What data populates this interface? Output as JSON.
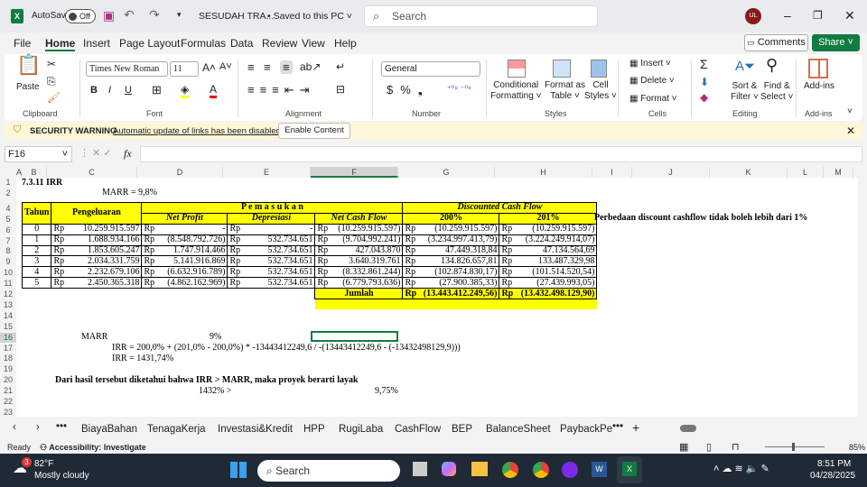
{
  "titlebar": {
    "autosave": "AutoSave",
    "autosave_state": "Off",
    "filename": "SESUDAH TRA...",
    "saved": "• Saved to this PC ˅",
    "search_placeholder": "Search",
    "user_initials": "UL"
  },
  "menu": [
    "File",
    "Home",
    "Insert",
    "Page Layout",
    "Formulas",
    "Data",
    "Review",
    "View",
    "Help"
  ],
  "comments_label": "Comments",
  "share_label": "Share",
  "ribbon": {
    "paste": "Paste",
    "font_name": "Times New Roman",
    "font_size": "11",
    "number_format": "General",
    "conditional": "Conditional",
    "formatting": "Formatting ˅",
    "format_as": "Format as",
    "table": "Table ˅",
    "cell": "Cell",
    "styles": "Styles ˅",
    "insert": "Insert",
    "delete": "Delete",
    "format": "Format ˅",
    "sort": "Sort &",
    "filter": "Filter ˅",
    "find": "Find &",
    "select": "Select ˅",
    "addins": "Add-ins",
    "groups": [
      "Clipboard",
      "Font",
      "Alignment",
      "Number",
      "Styles",
      "Cells",
      "Editing",
      "Add-ins"
    ]
  },
  "warning": {
    "title": "SECURITY WARNING",
    "message": "Automatic update of links has been disabled",
    "button": "Enable Content"
  },
  "formula_bar": {
    "name_box": "F16",
    "formula": ""
  },
  "columns": [
    "A",
    "B",
    "C",
    "D",
    "E",
    "F",
    "G",
    "H",
    "I",
    "J",
    "K",
    "L",
    "M"
  ],
  "rows": [
    "1",
    "2",
    "3",
    "4",
    "5",
    "6",
    "7",
    "8",
    "9",
    "10",
    "11",
    "12",
    "13",
    "14",
    "15",
    "16",
    "17",
    "18",
    "19",
    "20",
    "21",
    "22",
    "23"
  ],
  "sheet": {
    "title": "7.3.11 IRR",
    "marr": "MARR = 9,8%",
    "h_tahun": "Tahun",
    "h_pengeluaran": "Pengeluaran",
    "h_pemasukan": "P e m a s u k a n",
    "h_dcf": "Discounted Cash Flow",
    "h_netprofit": "Net Profit",
    "h_depresiasi": "Depresiasi",
    "h_ncf": "Net Cash Flow",
    "h_200": "200%",
    "h_201": "201%",
    "note": "Perbedaan discount cashflow tidak boleh lebih dari 1%",
    "rp": "Rp",
    "data": [
      [
        "0",
        "10.259.915.597",
        "-",
        "-",
        "(10.259.915.597)",
        "(10.259.915.597)",
        "(10.259.915.597)"
      ],
      [
        "1",
        "1.688.934.166",
        "(8.548.792.726)",
        "532.734.651",
        "(9.704.992.241)",
        "(3.234.997.413,79)",
        "(3.224.249.914,07)"
      ],
      [
        "2",
        "1.853.605.247",
        "1.747.914.466",
        "532.734.651",
        "427.043.870",
        "47.449.318,84",
        "47.134.564,69"
      ],
      [
        "3",
        "2.034.331.759",
        "5.141.916.869",
        "532.734.651",
        "3.640.319.761",
        "134.826.657,81",
        "133.487.329,98"
      ],
      [
        "4",
        "2.232.679.106",
        "(6.632.916.789)",
        "532.734.651",
        "(8.332.861.244)",
        "(102.874.830,17)",
        "(101.514.520,54)"
      ],
      [
        "5",
        "2.450.365.318",
        "(4.862.162.969)",
        "532.734.651",
        "(6.779.793.636)",
        "(27.900.385,33)",
        "(27.439.993,05)"
      ]
    ],
    "jumlah": "Jumlah",
    "total_200": "(13.443.412.249,56)",
    "total_201": "(13.432.498.129,90)",
    "marr_label": "MARR",
    "marr_value": "9%",
    "irr_formula": "IRR =  200,0% + (201,0%  -  200,0%) * -13443412249,6 / -(13443412249,6 - (-13432498129,9)))",
    "irr_result": "IRR = 1431,74%",
    "conclusion": "Dari hasil tersebut diketahui bahwa IRR > MARR, maka proyek berarti layak",
    "cmp_left": "1432% >",
    "cmp_right": "9,75%"
  },
  "sheet_tabs": [
    "BiayaBahan",
    "TenagaKerja",
    "Investasi&Kredit",
    "HPP",
    "RugiLaba",
    "CashFlow",
    "BEP",
    "BalanceSheet",
    "PaybackPe"
  ],
  "status": {
    "ready": "Ready",
    "accessibility": "Accessibility: Investigate",
    "zoom": "85%"
  },
  "taskbar": {
    "temp": "82°F",
    "weather": "Mostly cloudy",
    "badge": "3",
    "search": "Search",
    "time": "8:51 PM",
    "date": "04/28/2025"
  }
}
